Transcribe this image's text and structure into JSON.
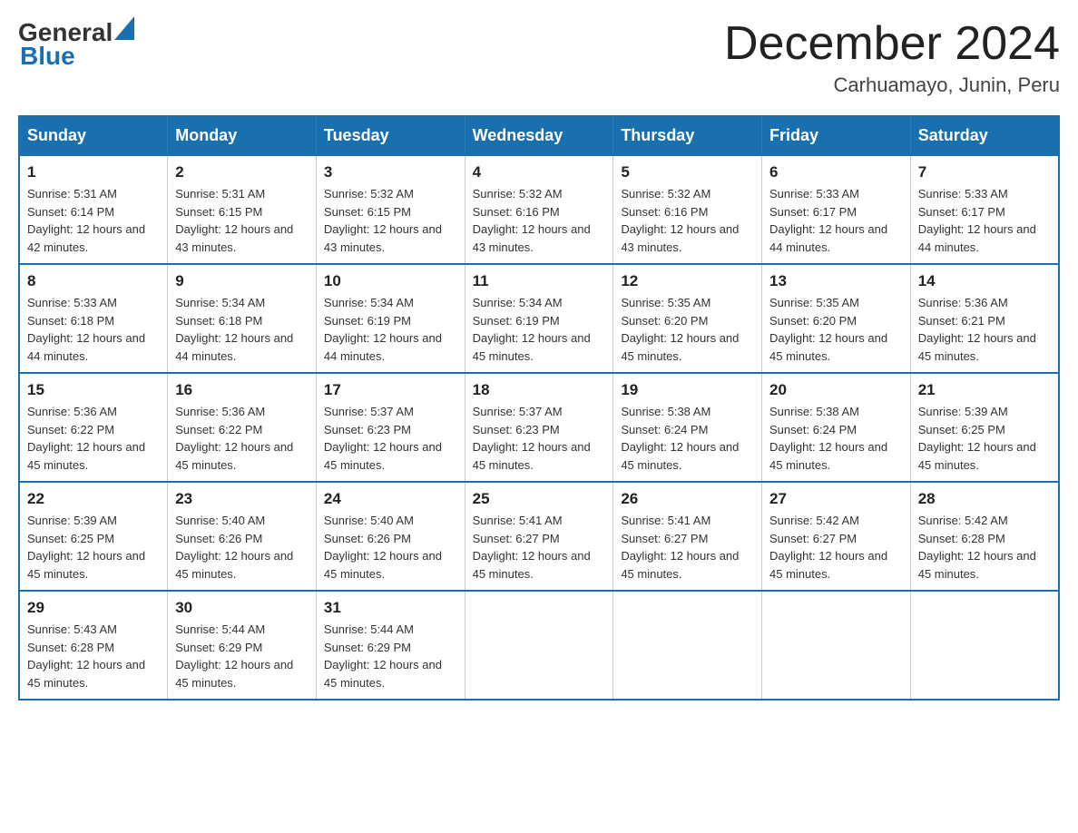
{
  "header": {
    "logo_general": "General",
    "logo_blue": "Blue",
    "month_title": "December 2024",
    "subtitle": "Carhuamayo, Junin, Peru"
  },
  "calendar": {
    "days_of_week": [
      "Sunday",
      "Monday",
      "Tuesday",
      "Wednesday",
      "Thursday",
      "Friday",
      "Saturday"
    ],
    "weeks": [
      [
        {
          "date": "1",
          "sunrise": "5:31 AM",
          "sunset": "6:14 PM",
          "daylight": "12 hours and 42 minutes."
        },
        {
          "date": "2",
          "sunrise": "5:31 AM",
          "sunset": "6:15 PM",
          "daylight": "12 hours and 43 minutes."
        },
        {
          "date": "3",
          "sunrise": "5:32 AM",
          "sunset": "6:15 PM",
          "daylight": "12 hours and 43 minutes."
        },
        {
          "date": "4",
          "sunrise": "5:32 AM",
          "sunset": "6:16 PM",
          "daylight": "12 hours and 43 minutes."
        },
        {
          "date": "5",
          "sunrise": "5:32 AM",
          "sunset": "6:16 PM",
          "daylight": "12 hours and 43 minutes."
        },
        {
          "date": "6",
          "sunrise": "5:33 AM",
          "sunset": "6:17 PM",
          "daylight": "12 hours and 44 minutes."
        },
        {
          "date": "7",
          "sunrise": "5:33 AM",
          "sunset": "6:17 PM",
          "daylight": "12 hours and 44 minutes."
        }
      ],
      [
        {
          "date": "8",
          "sunrise": "5:33 AM",
          "sunset": "6:18 PM",
          "daylight": "12 hours and 44 minutes."
        },
        {
          "date": "9",
          "sunrise": "5:34 AM",
          "sunset": "6:18 PM",
          "daylight": "12 hours and 44 minutes."
        },
        {
          "date": "10",
          "sunrise": "5:34 AM",
          "sunset": "6:19 PM",
          "daylight": "12 hours and 44 minutes."
        },
        {
          "date": "11",
          "sunrise": "5:34 AM",
          "sunset": "6:19 PM",
          "daylight": "12 hours and 45 minutes."
        },
        {
          "date": "12",
          "sunrise": "5:35 AM",
          "sunset": "6:20 PM",
          "daylight": "12 hours and 45 minutes."
        },
        {
          "date": "13",
          "sunrise": "5:35 AM",
          "sunset": "6:20 PM",
          "daylight": "12 hours and 45 minutes."
        },
        {
          "date": "14",
          "sunrise": "5:36 AM",
          "sunset": "6:21 PM",
          "daylight": "12 hours and 45 minutes."
        }
      ],
      [
        {
          "date": "15",
          "sunrise": "5:36 AM",
          "sunset": "6:22 PM",
          "daylight": "12 hours and 45 minutes."
        },
        {
          "date": "16",
          "sunrise": "5:36 AM",
          "sunset": "6:22 PM",
          "daylight": "12 hours and 45 minutes."
        },
        {
          "date": "17",
          "sunrise": "5:37 AM",
          "sunset": "6:23 PM",
          "daylight": "12 hours and 45 minutes."
        },
        {
          "date": "18",
          "sunrise": "5:37 AM",
          "sunset": "6:23 PM",
          "daylight": "12 hours and 45 minutes."
        },
        {
          "date": "19",
          "sunrise": "5:38 AM",
          "sunset": "6:24 PM",
          "daylight": "12 hours and 45 minutes."
        },
        {
          "date": "20",
          "sunrise": "5:38 AM",
          "sunset": "6:24 PM",
          "daylight": "12 hours and 45 minutes."
        },
        {
          "date": "21",
          "sunrise": "5:39 AM",
          "sunset": "6:25 PM",
          "daylight": "12 hours and 45 minutes."
        }
      ],
      [
        {
          "date": "22",
          "sunrise": "5:39 AM",
          "sunset": "6:25 PM",
          "daylight": "12 hours and 45 minutes."
        },
        {
          "date": "23",
          "sunrise": "5:40 AM",
          "sunset": "6:26 PM",
          "daylight": "12 hours and 45 minutes."
        },
        {
          "date": "24",
          "sunrise": "5:40 AM",
          "sunset": "6:26 PM",
          "daylight": "12 hours and 45 minutes."
        },
        {
          "date": "25",
          "sunrise": "5:41 AM",
          "sunset": "6:27 PM",
          "daylight": "12 hours and 45 minutes."
        },
        {
          "date": "26",
          "sunrise": "5:41 AM",
          "sunset": "6:27 PM",
          "daylight": "12 hours and 45 minutes."
        },
        {
          "date": "27",
          "sunrise": "5:42 AM",
          "sunset": "6:27 PM",
          "daylight": "12 hours and 45 minutes."
        },
        {
          "date": "28",
          "sunrise": "5:42 AM",
          "sunset": "6:28 PM",
          "daylight": "12 hours and 45 minutes."
        }
      ],
      [
        {
          "date": "29",
          "sunrise": "5:43 AM",
          "sunset": "6:28 PM",
          "daylight": "12 hours and 45 minutes."
        },
        {
          "date": "30",
          "sunrise": "5:44 AM",
          "sunset": "6:29 PM",
          "daylight": "12 hours and 45 minutes."
        },
        {
          "date": "31",
          "sunrise": "5:44 AM",
          "sunset": "6:29 PM",
          "daylight": "12 hours and 45 minutes."
        },
        null,
        null,
        null,
        null
      ]
    ]
  }
}
